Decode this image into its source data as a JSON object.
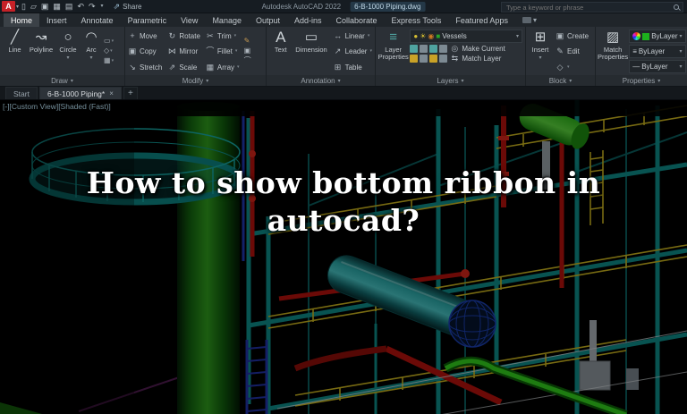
{
  "ui": {
    "caret_down": "▾"
  },
  "title_bar": {
    "logo": "A",
    "quick_access": [
      {
        "name": "new-file",
        "glyph": "▯"
      },
      {
        "name": "open-file",
        "glyph": "▱"
      },
      {
        "name": "save",
        "glyph": "▣"
      },
      {
        "name": "save-as",
        "glyph": "▦"
      },
      {
        "name": "plot",
        "glyph": "▤"
      },
      {
        "name": "undo",
        "glyph": "↶"
      },
      {
        "name": "redo",
        "glyph": "↷"
      }
    ],
    "share_glyph": "⇗",
    "share_label": "Share",
    "app_title": "Autodesk AutoCAD 2022",
    "document_title": "6-B-1000 Piping.dwg",
    "search_placeholder": "Type a keyword or phrase"
  },
  "ribbon": {
    "tabs": [
      "Home",
      "Insert",
      "Annotate",
      "Parametric",
      "View",
      "Manage",
      "Output",
      "Add-ins",
      "Collaborate",
      "Express Tools",
      "Featured Apps"
    ],
    "panels": {
      "draw": {
        "label": "Draw",
        "items": [
          {
            "label": "Line",
            "glyph": "╱"
          },
          {
            "label": "Polyline",
            "glyph": "↝"
          },
          {
            "label": "Circle",
            "glyph": "○"
          },
          {
            "label": "Arc",
            "glyph": "◠"
          }
        ],
        "extra": [
          {
            "name": "rectangle",
            "glyph": "▭"
          },
          {
            "name": "ellipse",
            "glyph": "◇"
          },
          {
            "name": "hatch",
            "glyph": "▦"
          }
        ]
      },
      "modify": {
        "label": "Modify",
        "items": [
          {
            "label": "Move",
            "glyph": "+"
          },
          {
            "label": "Copy",
            "glyph": "▣"
          },
          {
            "label": "Stretch",
            "glyph": "↘"
          },
          {
            "label": "Rotate",
            "glyph": "↻"
          },
          {
            "label": "Mirror",
            "glyph": "⋈"
          },
          {
            "label": "Scale",
            "glyph": "⇗"
          },
          {
            "label": "Trim",
            "glyph": "✂"
          },
          {
            "label": "Fillet",
            "glyph": "⌒"
          },
          {
            "label": "Array",
            "glyph": "▦"
          }
        ]
      },
      "annotation": {
        "label": "Annotation",
        "items": [
          {
            "label": "Text",
            "glyph": "A"
          },
          {
            "label": "Dimension",
            "glyph": "▭"
          },
          {
            "label": "Linear",
            "glyph": "↔"
          },
          {
            "label": "Leader",
            "glyph": "↗"
          },
          {
            "label": "Table",
            "glyph": "⊞"
          }
        ]
      },
      "layers": {
        "label": "Layers",
        "layer_properties_label": "Layer Properties",
        "layer_properties_glyph": "≡",
        "state_glyphs": [
          "●",
          "☀",
          "◉",
          "■"
        ],
        "current_layer": "Vessels",
        "make_current_label": "Make Current",
        "make_current_glyph": "◎",
        "match_layer_label": "Match Layer",
        "match_layer_glyph": "⇆"
      },
      "block": {
        "label": "Block",
        "insert_label": "Insert",
        "insert_glyph": "⊞",
        "create_label": "Create",
        "create_glyph": "▣",
        "edit_label": "Edit",
        "edit_glyph": "✎",
        "attributes_glyph": "◇"
      },
      "properties": {
        "label": "Properties",
        "match_properties_label": "Match Properties",
        "match_properties_glyph": "▨",
        "lineweight_glyph": "≡",
        "linetype_glyph": "—",
        "bylayer_values": [
          "ByLayer",
          "ByLayer",
          "ByLayer"
        ]
      }
    }
  },
  "file_tabs": {
    "tabs": [
      {
        "label": "Start"
      },
      {
        "label": "6-B-1000 Piping*"
      }
    ],
    "close_glyph": "×",
    "new_tab_glyph": "+"
  },
  "viewport": {
    "controls": "[-][Custom View][Shaded (Fast)]",
    "headline_line1": "How to show bottom ribbon in",
    "headline_line2": "autocad?"
  },
  "colors": {
    "logo_red": "#c62127",
    "tab_active_bg": "#3b4147",
    "scene_teal": "#0e8a88",
    "scene_green_column": "#2f9b1d",
    "scene_yellow_rail": "#c9b31f",
    "scene_red_pipe": "#b3120c",
    "scene_cyan_tank": "#2ba8a8",
    "headline_text": "#ffffff"
  }
}
